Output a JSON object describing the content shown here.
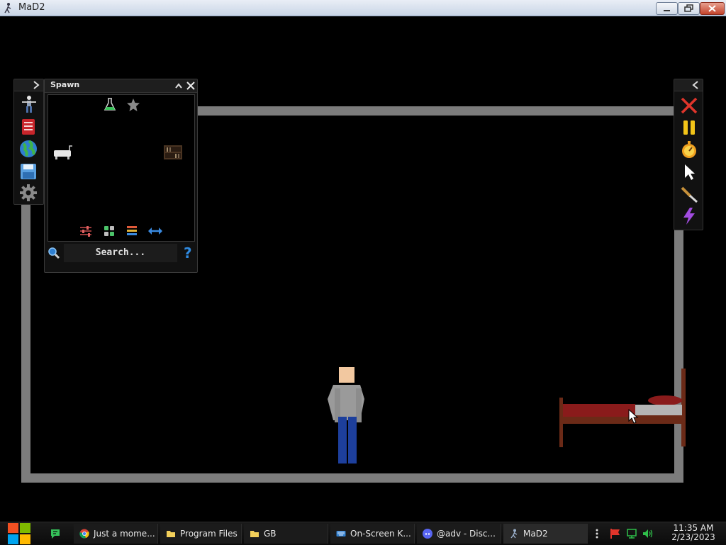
{
  "window": {
    "title": "MaD2"
  },
  "spawn_panel": {
    "title": "Spawn",
    "search_placeholder": "Search..."
  },
  "taskbar": {
    "items": [
      {
        "label": "Just a mome..."
      },
      {
        "label": "Program Files"
      },
      {
        "label": "GB"
      },
      {
        "label": "On-Screen K..."
      },
      {
        "label": "@adv - Disc..."
      },
      {
        "label": "MaD2"
      }
    ],
    "time": "11:35 AM",
    "date": "2/23/2023"
  },
  "colors": {
    "wall": "#7c7c7c",
    "bed_frame": "#6b2a17",
    "bed_sheet": "#8a1b1b",
    "pillow": "#b5b5b5",
    "person_shirt": "#9a9a9a",
    "person_pants": "#1d3f9c",
    "person_skin": "#f2c8a0"
  }
}
